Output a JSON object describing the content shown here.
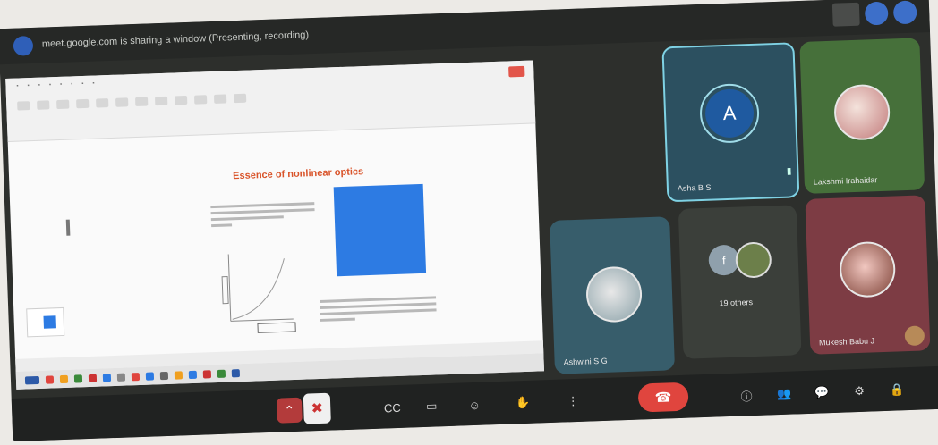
{
  "window": {
    "title": "meet.google.com is sharing a window (Presenting, recording)"
  },
  "slide": {
    "title": "Essence of nonlinear optics"
  },
  "participants": [
    {
      "name": "Asha B S",
      "initial": "A"
    },
    {
      "name": "Lakshmi Irahaidar"
    },
    {
      "name": "Ashwini S G"
    },
    {
      "name": "19 others",
      "initial": "f"
    },
    {
      "name": "Mukesh Babu J"
    }
  ],
  "icons": {
    "present_chevron": "⌃",
    "mic_off": "✖",
    "captions": "CC",
    "present": "▭",
    "emoji": "☺",
    "raise_hand": "✋",
    "more": "⋮",
    "leave": "☎",
    "info": "ⓘ",
    "people": "👥",
    "chat": "💬",
    "activities": "⚙",
    "lock": "🔒"
  },
  "colors": {
    "leave": "#e0453e",
    "accent": "#2d7be3",
    "active_tile_border": "#7fd2e4"
  }
}
